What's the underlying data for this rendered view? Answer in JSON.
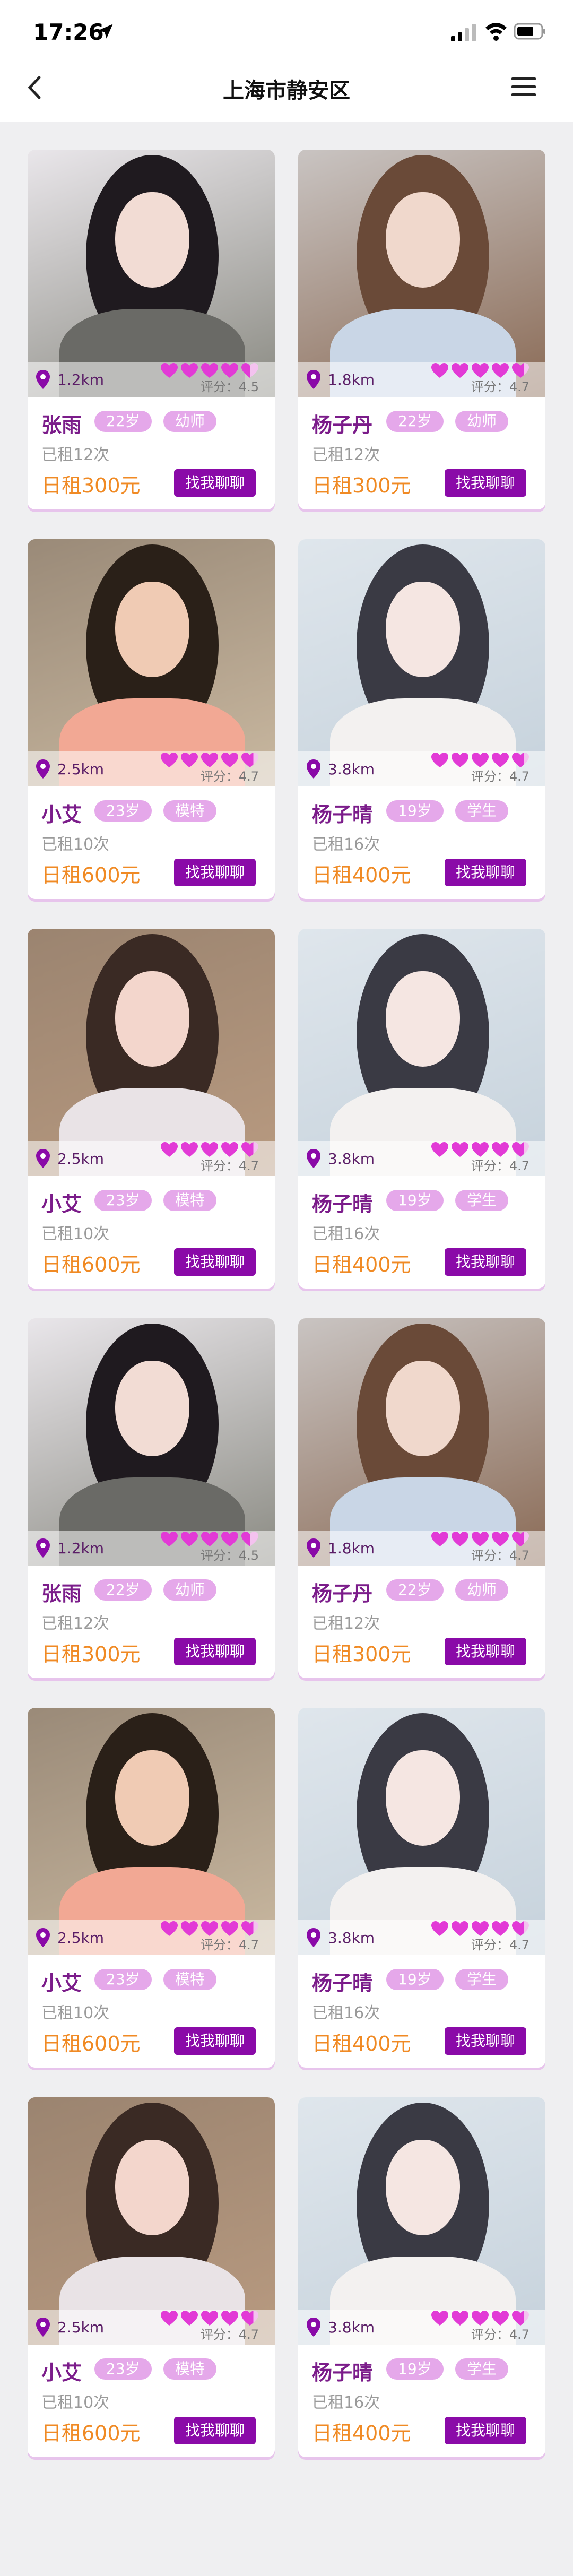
{
  "status_bar": {
    "time": "17:26"
  },
  "header": {
    "title": "上海市静安区"
  },
  "colors": {
    "accent": "#8a0aa8",
    "price": "#f08a24",
    "tag": "#e5a8ea",
    "name": "#7b1c8a"
  },
  "icons": {
    "back": "chevron-left-icon",
    "menu": "hamburger-menu-icon",
    "location": "location-pin-icon",
    "rating": "heart-icon"
  },
  "cards": [
    {
      "name": "张雨",
      "age": "22岁",
      "job": "幼师",
      "distance": "1.2km",
      "rating_label": "评分：4.5",
      "rating": 4.5,
      "rented": "已租12次",
      "price": "日租300元",
      "button": "找我聊聊"
    },
    {
      "name": "杨子丹",
      "age": "22岁",
      "job": "幼师",
      "distance": "1.8km",
      "rating_label": "评分：4.7",
      "rating": 4.7,
      "rented": "已租12次",
      "price": "日租300元",
      "button": "找我聊聊"
    },
    {
      "name": "小艾",
      "age": "23岁",
      "job": "模特",
      "distance": "2.5km",
      "rating_label": "评分：4.7",
      "rating": 4.7,
      "rented": "已租10次",
      "price": "日租600元",
      "button": "找我聊聊"
    },
    {
      "name": "杨子晴",
      "age": "19岁",
      "job": "学生",
      "distance": "3.8km",
      "rating_label": "评分：4.7",
      "rating": 4.7,
      "rented": "已租16次",
      "price": "日租400元",
      "button": "找我聊聊"
    },
    {
      "name": "小艾",
      "age": "23岁",
      "job": "模特",
      "distance": "2.5km",
      "rating_label": "评分：4.7",
      "rating": 4.7,
      "rented": "已租10次",
      "price": "日租600元",
      "button": "找我聊聊"
    },
    {
      "name": "杨子晴",
      "age": "19岁",
      "job": "学生",
      "distance": "3.8km",
      "rating_label": "评分：4.7",
      "rating": 4.7,
      "rented": "已租16次",
      "price": "日租400元",
      "button": "找我聊聊"
    },
    {
      "name": "张雨",
      "age": "22岁",
      "job": "幼师",
      "distance": "1.2km",
      "rating_label": "评分：4.5",
      "rating": 4.5,
      "rented": "已租12次",
      "price": "日租300元",
      "button": "找我聊聊"
    },
    {
      "name": "杨子丹",
      "age": "22岁",
      "job": "幼师",
      "distance": "1.8km",
      "rating_label": "评分：4.7",
      "rating": 4.7,
      "rented": "已租12次",
      "price": "日租300元",
      "button": "找我聊聊"
    },
    {
      "name": "小艾",
      "age": "23岁",
      "job": "模特",
      "distance": "2.5km",
      "rating_label": "评分：4.7",
      "rating": 4.7,
      "rented": "已租10次",
      "price": "日租600元",
      "button": "找我聊聊"
    },
    {
      "name": "杨子晴",
      "age": "19岁",
      "job": "学生",
      "distance": "3.8km",
      "rating_label": "评分：4.7",
      "rating": 4.7,
      "rented": "已租16次",
      "price": "日租400元",
      "button": "找我聊聊"
    },
    {
      "name": "小艾",
      "age": "23岁",
      "job": "模特",
      "distance": "2.5km",
      "rating_label": "评分：4.7",
      "rating": 4.7,
      "rented": "已租10次",
      "price": "日租600元",
      "button": "找我聊聊"
    },
    {
      "name": "杨子晴",
      "age": "19岁",
      "job": "学生",
      "distance": "3.8km",
      "rating_label": "评分：4.7",
      "rating": 4.7,
      "rented": "已租16次",
      "price": "日租400元",
      "button": "找我聊聊"
    }
  ]
}
